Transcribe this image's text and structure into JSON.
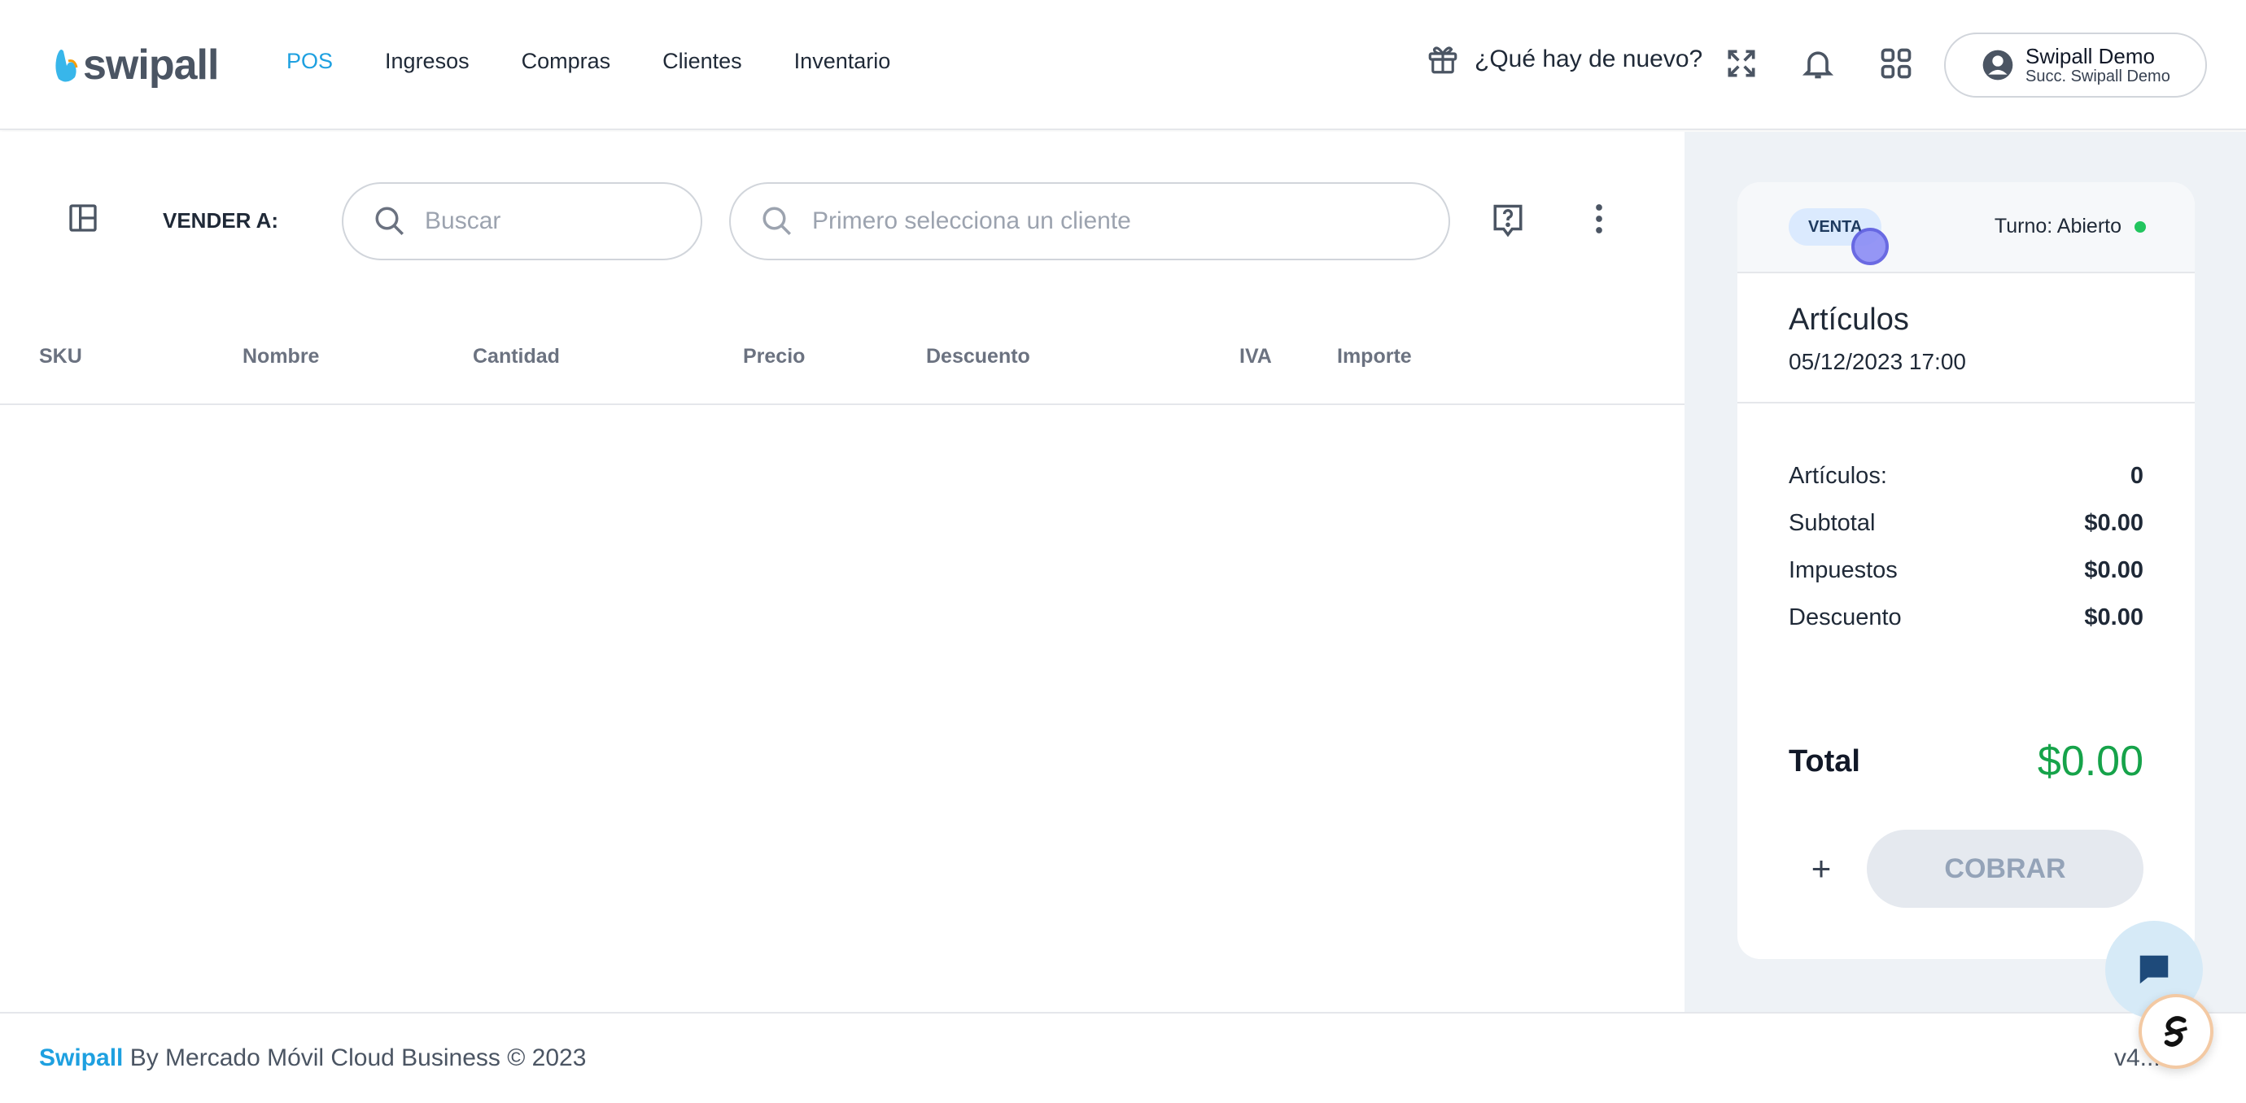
{
  "header": {
    "logo_text": "swipall",
    "nav": [
      {
        "label": "POS",
        "active": true
      },
      {
        "label": "Ingresos",
        "active": false
      },
      {
        "label": "Compras",
        "active": false
      },
      {
        "label": "Clientes",
        "active": false
      },
      {
        "label": "Inventario",
        "active": false
      }
    ],
    "news_label": "¿Qué hay de nuevo?",
    "icons": [
      "gift-icon",
      "fullscreen-icon",
      "bell-icon",
      "apps-grid-icon"
    ],
    "user": {
      "name": "Swipall Demo",
      "branch": "Succ. Swipall Demo"
    }
  },
  "toolbar": {
    "sell_to_label": "VENDER A:",
    "search_placeholder": "Buscar",
    "client_placeholder": "Primero selecciona un cliente"
  },
  "table": {
    "columns": [
      "SKU",
      "Nombre",
      "Cantidad",
      "Precio",
      "Descuento",
      "IVA",
      "Importe"
    ],
    "rows": []
  },
  "summary": {
    "badge": "VENTA",
    "shift": "Turno: Abierto",
    "title": "Artículos",
    "datetime": "05/12/2023 17:00",
    "lines": [
      {
        "label": "Artículos:",
        "value": "0"
      },
      {
        "label": "Subtotal",
        "value": "$0.00"
      },
      {
        "label": "Impuestos",
        "value": "$0.00"
      },
      {
        "label": "Descuento",
        "value": "$0.00"
      }
    ],
    "total_label": "Total",
    "total_value": "$0.00",
    "plus_label": "+",
    "charge_label": "COBRAR"
  },
  "footer": {
    "brand": "Swipall",
    "text": " By Mercado Móvil Cloud Business © 2023",
    "version": "v4..."
  },
  "colors": {
    "accent": "#1ea0e0",
    "total": "#16a34a",
    "status_dot": "#22c55e"
  }
}
